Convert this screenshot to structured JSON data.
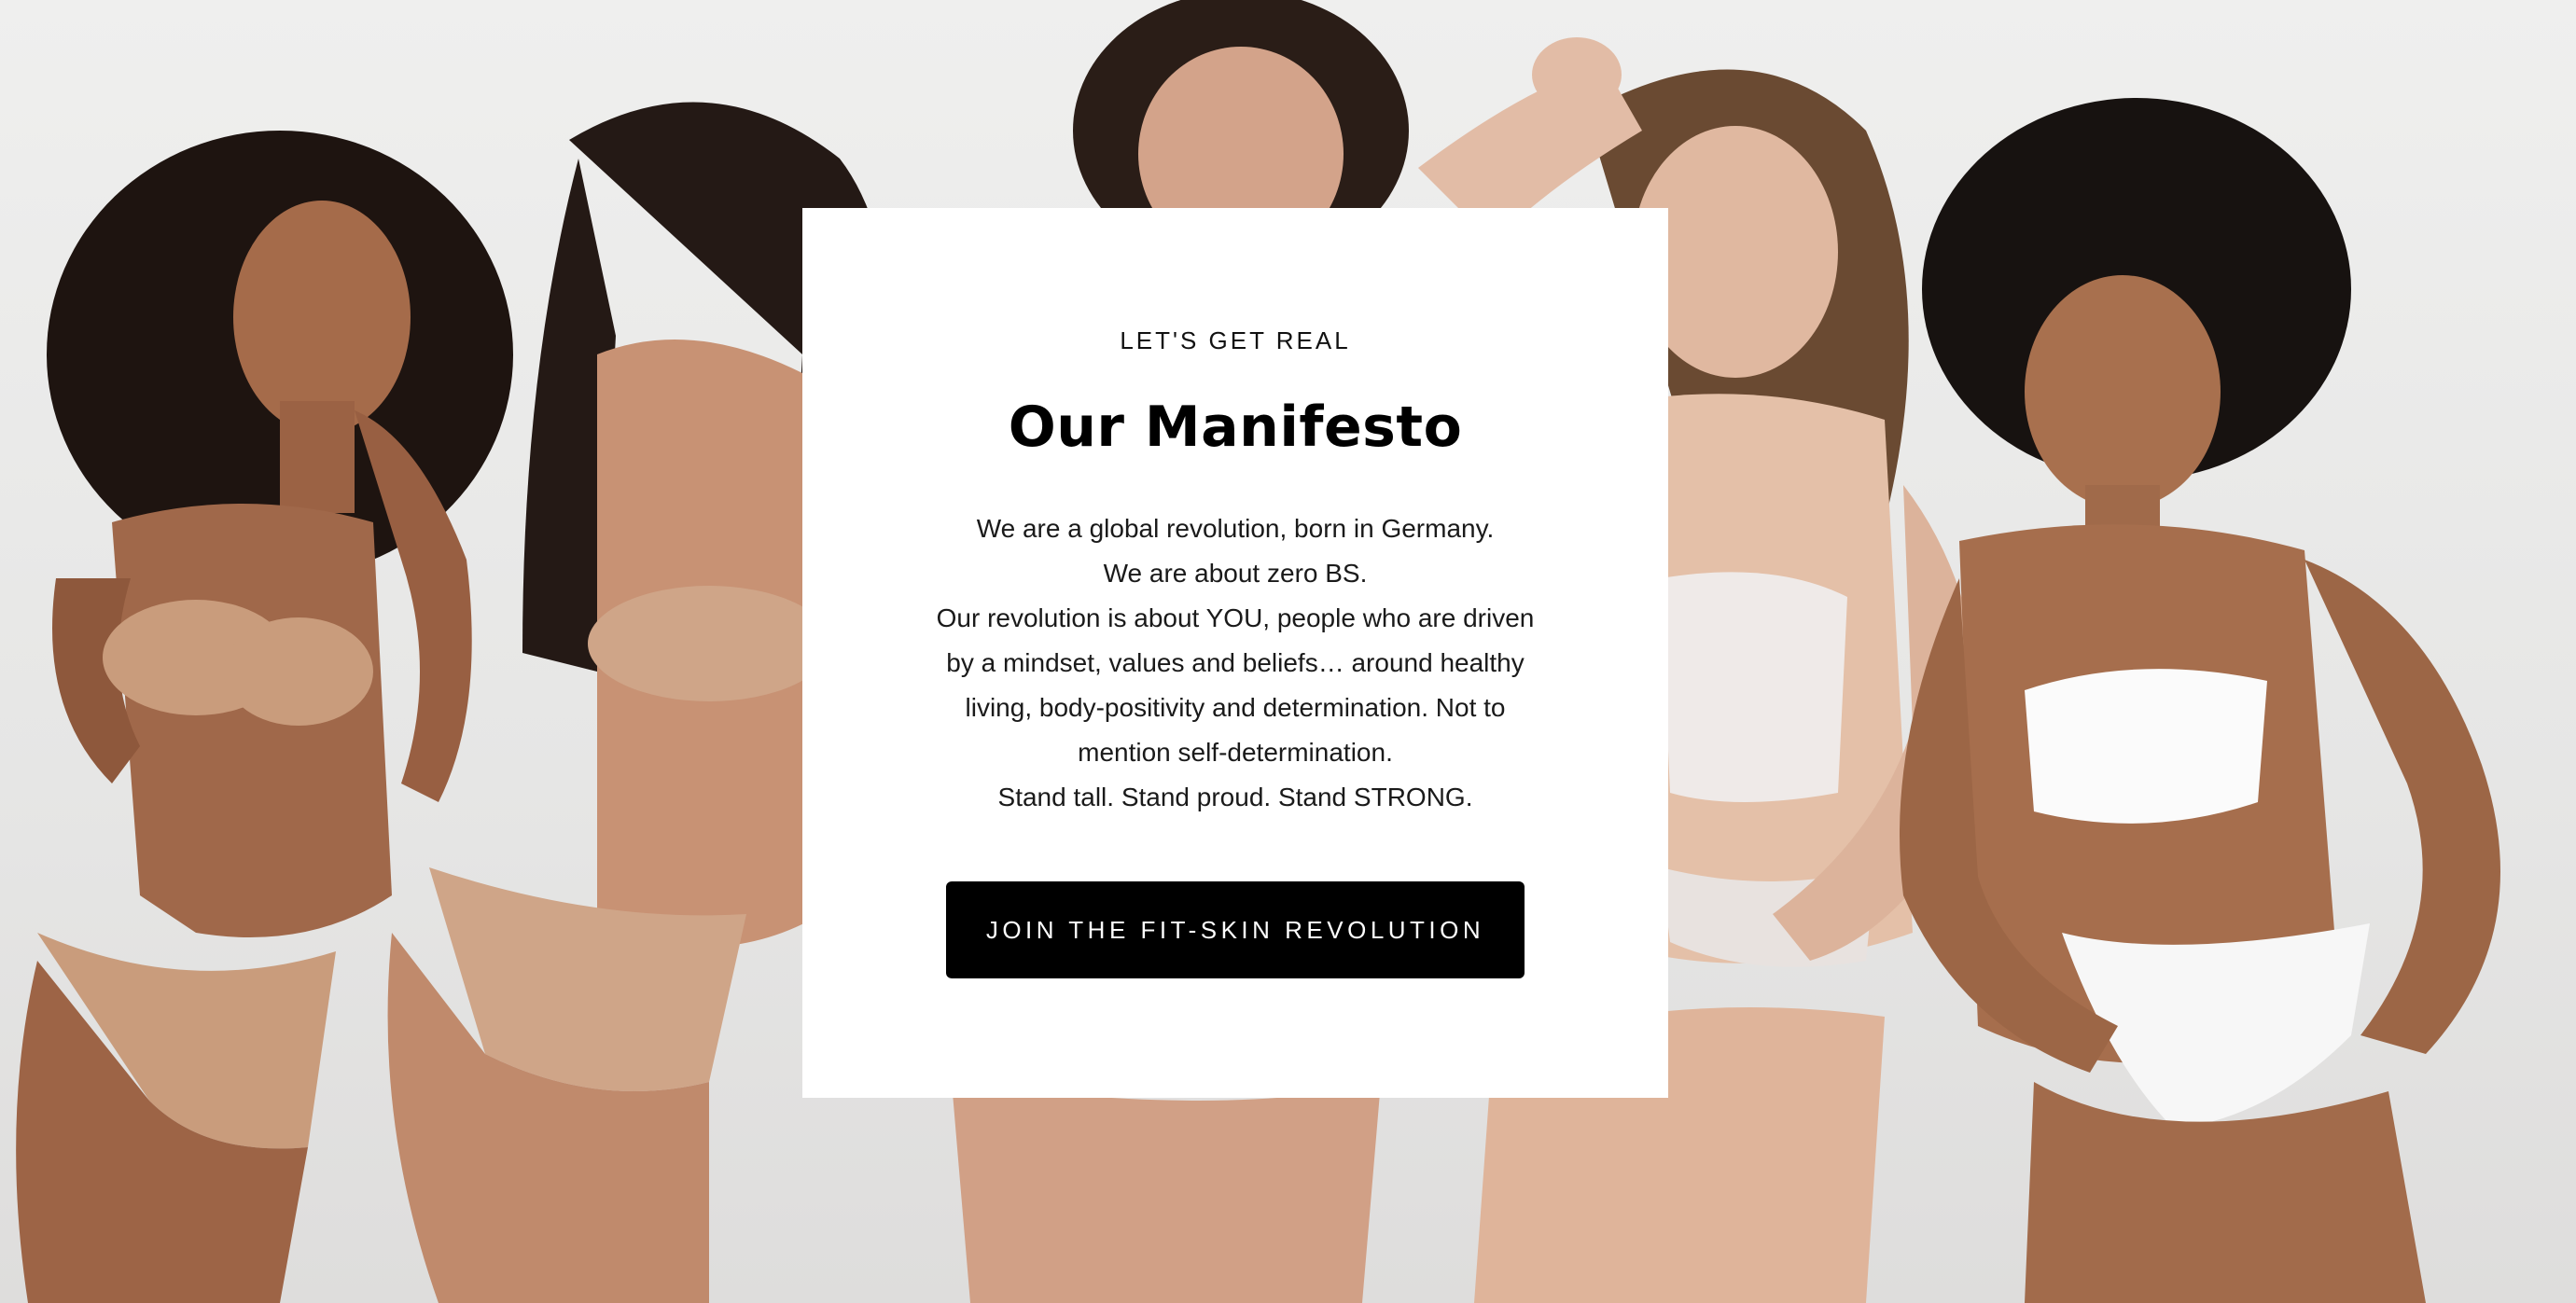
{
  "background": {
    "photo": "group-of-five-women-in-lingerie",
    "color": "#e9e9e8"
  },
  "manifesto": {
    "eyebrow": "LET'S GET REAL",
    "title": "Our Manifesto",
    "lines": [
      "We are a global revolution, born in Germany.",
      "We are about zero BS.",
      "Our revolution is about YOU, people who are driven",
      "by a mindset, values and beliefs… around healthy",
      "living, body-positivity and determination. Not to",
      "mention self-determination.",
      "Stand tall. Stand proud. Stand STRONG."
    ],
    "cta_label": "JOIN THE FIT-SKIN REVOLUTION"
  },
  "colors": {
    "card": "#ffffff",
    "button": "#000000",
    "button_text": "#ffffff",
    "text": "#1a1a1a"
  }
}
